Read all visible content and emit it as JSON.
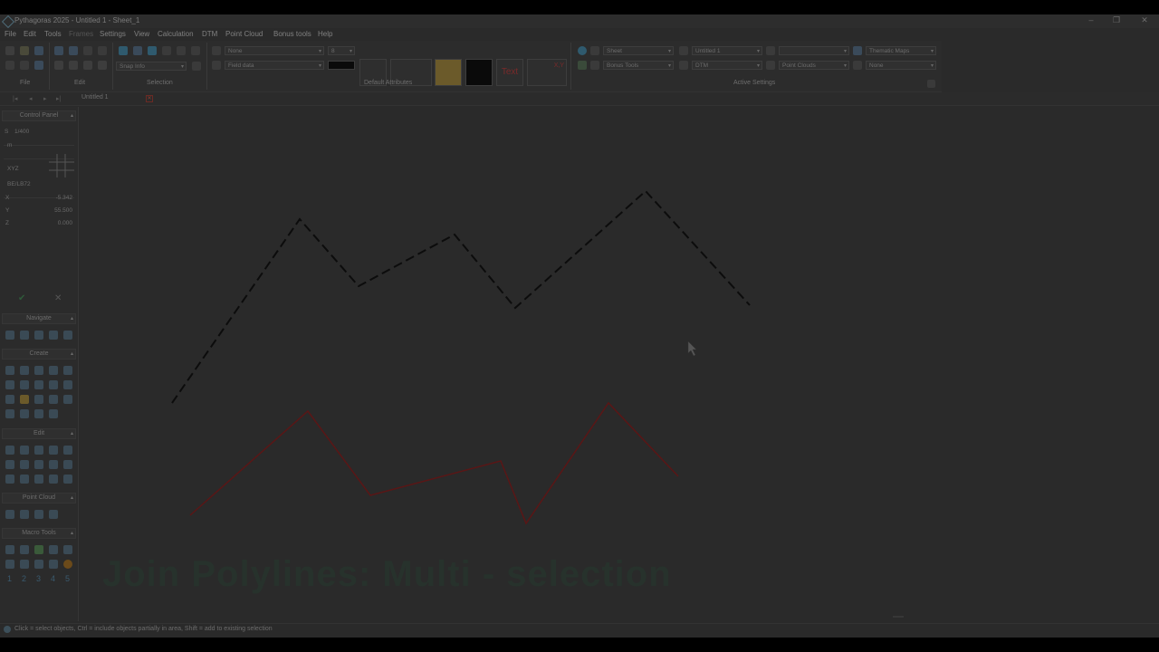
{
  "window": {
    "title": "Pythagoras 2025 - Untitled 1 - Sheet_1",
    "controls": [
      "–",
      "❐",
      "✕"
    ]
  },
  "menu": [
    {
      "label": "File",
      "enabled": true
    },
    {
      "label": "Edit",
      "enabled": true
    },
    {
      "label": "Tools",
      "enabled": true
    },
    {
      "label": "Frames",
      "enabled": false
    },
    {
      "label": "Settings",
      "enabled": true
    },
    {
      "label": "View",
      "enabled": true
    },
    {
      "label": "Calculation",
      "enabled": true
    },
    {
      "label": "DTM",
      "enabled": true
    },
    {
      "label": "Point Cloud",
      "enabled": true
    },
    {
      "label": "Bonus tools",
      "enabled": true
    },
    {
      "label": "Help",
      "enabled": true
    }
  ],
  "ribbon": {
    "groups": {
      "file": "File",
      "edit": "Edit",
      "selection": "Selection",
      "default_attributes": "Default Attributes",
      "active_settings": "Active Settings"
    },
    "selection_combo": "Snap Info",
    "layer_combo": "None",
    "size_combo": "8",
    "data_combo": "Field data",
    "text_button": "Text",
    "xy_button": "X,Y",
    "sheet_combo": "Sheet",
    "project_combo": "Untitled 1",
    "tools_combo": "Bonus Tools",
    "dtm_combo": "DTM",
    "cloud_combo": "Point Clouds",
    "thematic_combo": "Thematic Maps",
    "thematic_value": "None",
    "colors": {
      "gold": "#6b5a2a",
      "black": "#0a0a0a",
      "text_red": "#7a2a2a"
    }
  },
  "doc_tab": {
    "label": "Untitled 1"
  },
  "left_panel": {
    "control_panel": "Control Panel",
    "scale_label": "S",
    "scale_value": "1/400",
    "unit": "m",
    "xyz_label": "XYZ",
    "coord_system": "BE/LB72",
    "x_label": "X",
    "x_value": "-5.342",
    "y_label": "Y",
    "y_value": "55.500",
    "z_label": "Z",
    "z_value": "0.000",
    "navigate": "Navigate",
    "create": "Create",
    "edit": "Edit",
    "point_cloud": "Point Cloud",
    "macro_tools": "Macro Tools",
    "macro_numbers": [
      "1",
      "2",
      "3",
      "4",
      "5"
    ]
  },
  "canvas": {
    "overlay_title": "Join Polylines: Multi - selection",
    "dashed_polyline": [
      [
        190,
        445
      ],
      [
        331,
        242
      ],
      [
        396,
        316
      ],
      [
        502,
        259
      ],
      [
        569,
        340
      ],
      [
        713,
        211
      ],
      [
        828,
        337
      ]
    ],
    "solid_polyline": [
      [
        210,
        569
      ],
      [
        340,
        454
      ],
      [
        409,
        547
      ],
      [
        553,
        509
      ],
      [
        581,
        578
      ],
      [
        672,
        445
      ],
      [
        749,
        526
      ]
    ],
    "solid_color": "#5a1616",
    "dashed_color": "#0c0c0c"
  },
  "status": {
    "text": "Click = select objects, Ctrl = include objects partially in area, Shift = add to existing selection"
  }
}
